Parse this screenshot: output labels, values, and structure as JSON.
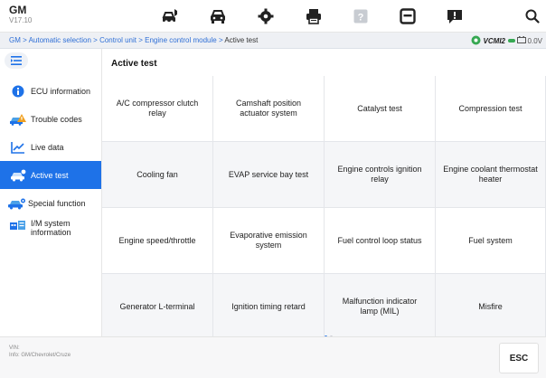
{
  "app": {
    "brand": "GM",
    "version": "V17.10"
  },
  "toolbar": {
    "icons": [
      "car-home-icon",
      "car-icon",
      "settings-gear-icon",
      "printer-icon",
      "help-icon",
      "save-icon",
      "message-icon",
      "search-icon"
    ]
  },
  "breadcrumb": {
    "items": [
      "GM",
      "Automatic selection",
      "Control unit",
      "Engine control module"
    ],
    "separator": " > ",
    "current": "Active test"
  },
  "status": {
    "vci_label": "VCMI2",
    "voltage": "0.0V"
  },
  "sidebar": {
    "items": [
      {
        "label": "ECU information",
        "icon": "info-icon"
      },
      {
        "label": "Trouble codes",
        "icon": "trouble-codes-icon"
      },
      {
        "label": "Live data",
        "icon": "live-data-icon"
      },
      {
        "label": "Active test",
        "icon": "active-test-icon",
        "active": true
      },
      {
        "label": "Special function",
        "icon": "special-function-icon"
      },
      {
        "label": "I/M system information",
        "icon": "im-system-icon"
      }
    ]
  },
  "main": {
    "title": "Active test",
    "tests": [
      "A/C compressor clutch relay",
      "Camshaft position actuator system",
      "Catalyst test",
      "Compression test",
      "Cooling fan",
      "EVAP service bay test",
      "Engine controls ignition relay",
      "Engine coolant thermostat heater",
      "Engine speed/throttle",
      "Evaporative emission system",
      "Fuel control loop status",
      "Fuel system",
      "Generator L-terminal",
      "Ignition timing retard",
      "Malfunction indicator lamp (MIL)",
      "Misfire"
    ],
    "page_count": 2,
    "current_page": 1
  },
  "footer": {
    "vin_label": "VIN:",
    "info": "Info: GM/Chevrolet/Cruze",
    "esc_label": "ESC"
  },
  "colors": {
    "accent": "#1e72e8",
    "breadcrumb_link": "#2f6fd6",
    "green": "#36a852"
  }
}
